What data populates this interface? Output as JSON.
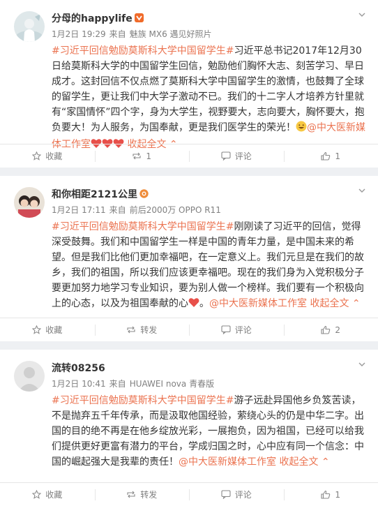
{
  "posts": [
    {
      "name": "分母的happylife",
      "meta": {
        "date": "1月2日 19:29",
        "source_prefix": "来自",
        "device": "魅族 MX6 遇见好照片"
      },
      "segments": [
        {
          "t": "tag",
          "text": "#习近平回信勉励莫斯科大学中国留学生#"
        },
        {
          "t": "text",
          "text": "习近平总书记2017年12月30日给莫斯科大学的中国留学生回信，勉励他们胸怀大志、刻苦学习、早日成才。这封回信不仅点燃了莫斯科大学中国留学生的激情，也鼓舞了全球的留学生，更让我们中大学子激动不已。我们的十二字人才培养方针里就有“家国情怀”四个字，身为大学生，视野要大，志向要大，胸怀要大，抱负要大！为人服务，为国奉献，更是我们医学生的荣光！"
        },
        {
          "t": "emoji",
          "name": "grin-emoji"
        },
        {
          "t": "at",
          "text": "@中大医新媒体工作室"
        },
        {
          "t": "emoji",
          "name": "heart-emoji"
        },
        {
          "t": "emoji",
          "name": "heart-emoji"
        },
        {
          "t": "emoji",
          "name": "heart-emoji"
        },
        {
          "t": "collapse",
          "text": " 收起全文 ⌃"
        }
      ],
      "actions": {
        "favorite": "收藏",
        "repost": "1",
        "comment": "评论",
        "like": "1"
      }
    },
    {
      "name": "和你相距2121公里",
      "meta": {
        "date": "1月2日 17:11",
        "source_prefix": "来自",
        "device": "前后2000万 OPPO R11"
      },
      "segments": [
        {
          "t": "tag",
          "text": "#习近平回信勉励莫斯科大学中国留学生#"
        },
        {
          "t": "text",
          "text": "刚刚读了习近平的回信，觉得深受鼓舞。我们和中国留学生一样是中国的青年力量，是中国未来的希望。但是我们比他们更加幸福吧，在一定意义上。我们元旦是在我们的故乡，我们的祖国，所以我们应该更幸福吧。现在的我们身为入党积极分子要更加努力地学习专业知识，要为别人做一个榜样。我们要有一个积极向上的心态，以及为祖国奉献的心"
        },
        {
          "t": "emoji",
          "name": "heart-emoji"
        },
        {
          "t": "text",
          "text": "。"
        },
        {
          "t": "at",
          "text": "@中大医新媒体工作室"
        },
        {
          "t": "collapse",
          "text": " 收起全文 ⌃"
        }
      ],
      "actions": {
        "favorite": "收藏",
        "repost": "转发",
        "comment": "评论",
        "like": "2"
      }
    },
    {
      "name": "流转08256",
      "meta": {
        "date": "1月2日 10:41",
        "source_prefix": "来自",
        "device": "HUAWEI nova 青春版"
      },
      "segments": [
        {
          "t": "tag",
          "text": "#习近平回信勉励莫斯科大学中国留学生#"
        },
        {
          "t": "text",
          "text": "游子远赴异国他乡负笈苦读，不是抛弃五千年传承，而是汲取他国经验，萦绕心头的仍是中华二字。出国的目的绝不再是在他乡绽放光彩，一展抱负，因为祖国，已经可以给我们提供更好更富有潜力的平台，学成归国之时，心中应有同一个信念：中国的崛起强大是我辈的责任！"
        },
        {
          "t": "at",
          "text": "@中大医新媒体工作室"
        },
        {
          "t": "collapse",
          "text": " 收起全文 ⌃"
        }
      ],
      "actions": {
        "favorite": "收藏",
        "repost": "转发",
        "comment": "评论",
        "like": "1"
      }
    }
  ],
  "colors": {
    "accent": "#eb7350",
    "meta": "#808080",
    "text": "#333333",
    "badge_gold": "#f5a623",
    "badge_red": "#e8504a"
  }
}
